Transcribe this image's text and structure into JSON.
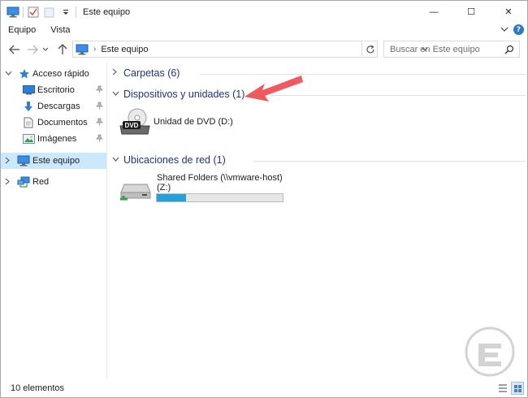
{
  "window": {
    "title": "Este equipo",
    "controls": {
      "minimize": "—",
      "maximize": "☐",
      "close": "✕"
    }
  },
  "ribbon": {
    "tabs": [
      "Equipo",
      "Vista"
    ],
    "help": "?"
  },
  "navigation": {
    "address_path": "Este equipo",
    "search_placeholder": "Buscar en Este equipo"
  },
  "sidebar": {
    "quick_access": "Acceso rápido",
    "items": [
      {
        "label": "Escritorio",
        "icon": "desktop-folder-icon"
      },
      {
        "label": "Descargas",
        "icon": "downloads-icon"
      },
      {
        "label": "Documentos",
        "icon": "documents-icon"
      },
      {
        "label": "Imágenes",
        "icon": "pictures-icon"
      }
    ],
    "this_pc": "Este equipo",
    "network": "Red"
  },
  "content": {
    "groups": [
      {
        "title": "Carpetas (6)",
        "expanded": false
      },
      {
        "title": "Dispositivos y unidades (1)",
        "expanded": true
      },
      {
        "title": "Ubicaciones de red (1)",
        "expanded": true
      }
    ],
    "dvd_drive": {
      "label": "Unidad de DVD (D:)",
      "badge": "DVD"
    },
    "network_drive": {
      "label_line1": "Shared Folders (\\\\vmware-host)",
      "label_line2": "(Z:)",
      "used_fraction": 0.23
    }
  },
  "status_bar": {
    "count": "10 elementos"
  },
  "colors": {
    "selection": "#cce8ff",
    "group_title": "#1e3287",
    "progress_fill": "#26a0da",
    "annotation_arrow": "#f05a5f"
  }
}
